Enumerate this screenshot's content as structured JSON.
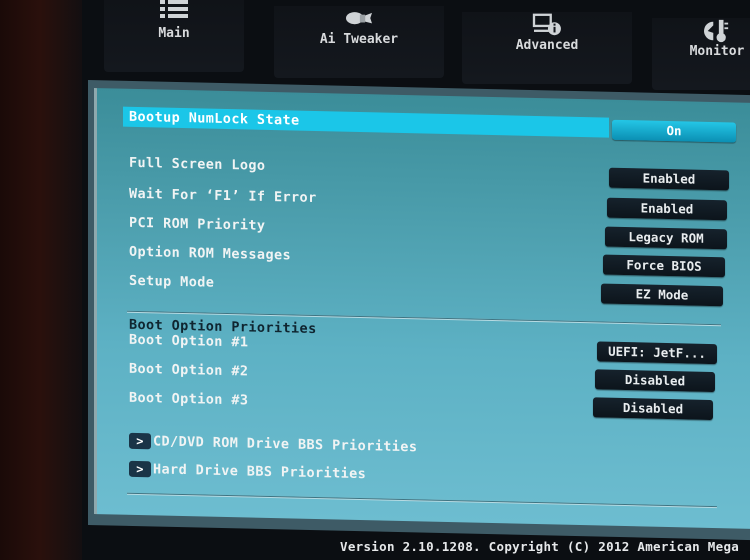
{
  "tabs": [
    {
      "label": "Main",
      "icon": "list-icon"
    },
    {
      "label": "Ai Tweaker",
      "icon": "rocket-icon"
    },
    {
      "label": "Advanced",
      "icon": "monitor-info-icon"
    },
    {
      "label": "Monitor",
      "icon": "thermometer-icon"
    }
  ],
  "settings": [
    {
      "label": "Bootup NumLock State",
      "value": "On",
      "selected": true
    },
    {
      "label": "Full Screen Logo",
      "value": "Enabled"
    },
    {
      "label": "Wait For ‘F1’ If Error",
      "value": "Enabled"
    },
    {
      "label": "PCI ROM Priority",
      "value": "Legacy ROM"
    },
    {
      "label": "Option ROM Messages",
      "value": "Force BIOS"
    },
    {
      "label": "Setup Mode",
      "value": "EZ Mode"
    }
  ],
  "boot_section": {
    "title": "Boot Option Priorities",
    "options": [
      {
        "label": "Boot Option #1",
        "value": "UEFI: JetF..."
      },
      {
        "label": "Boot Option #2",
        "value": "Disabled"
      },
      {
        "label": "Boot Option #3",
        "value": "Disabled"
      }
    ]
  },
  "submenus": [
    {
      "arrow": ">",
      "label": "CD/DVD ROM Drive BBS Priorities"
    },
    {
      "arrow": ">",
      "label": "Hard Drive BBS Priorities"
    }
  ],
  "footer": {
    "text": "Version 2.10.1208. Copyright (C) 2012 American Mega"
  },
  "colors": {
    "highlight": "#1bc6e8",
    "panel": "#5db1c4",
    "value_bg": "#0c141b"
  }
}
